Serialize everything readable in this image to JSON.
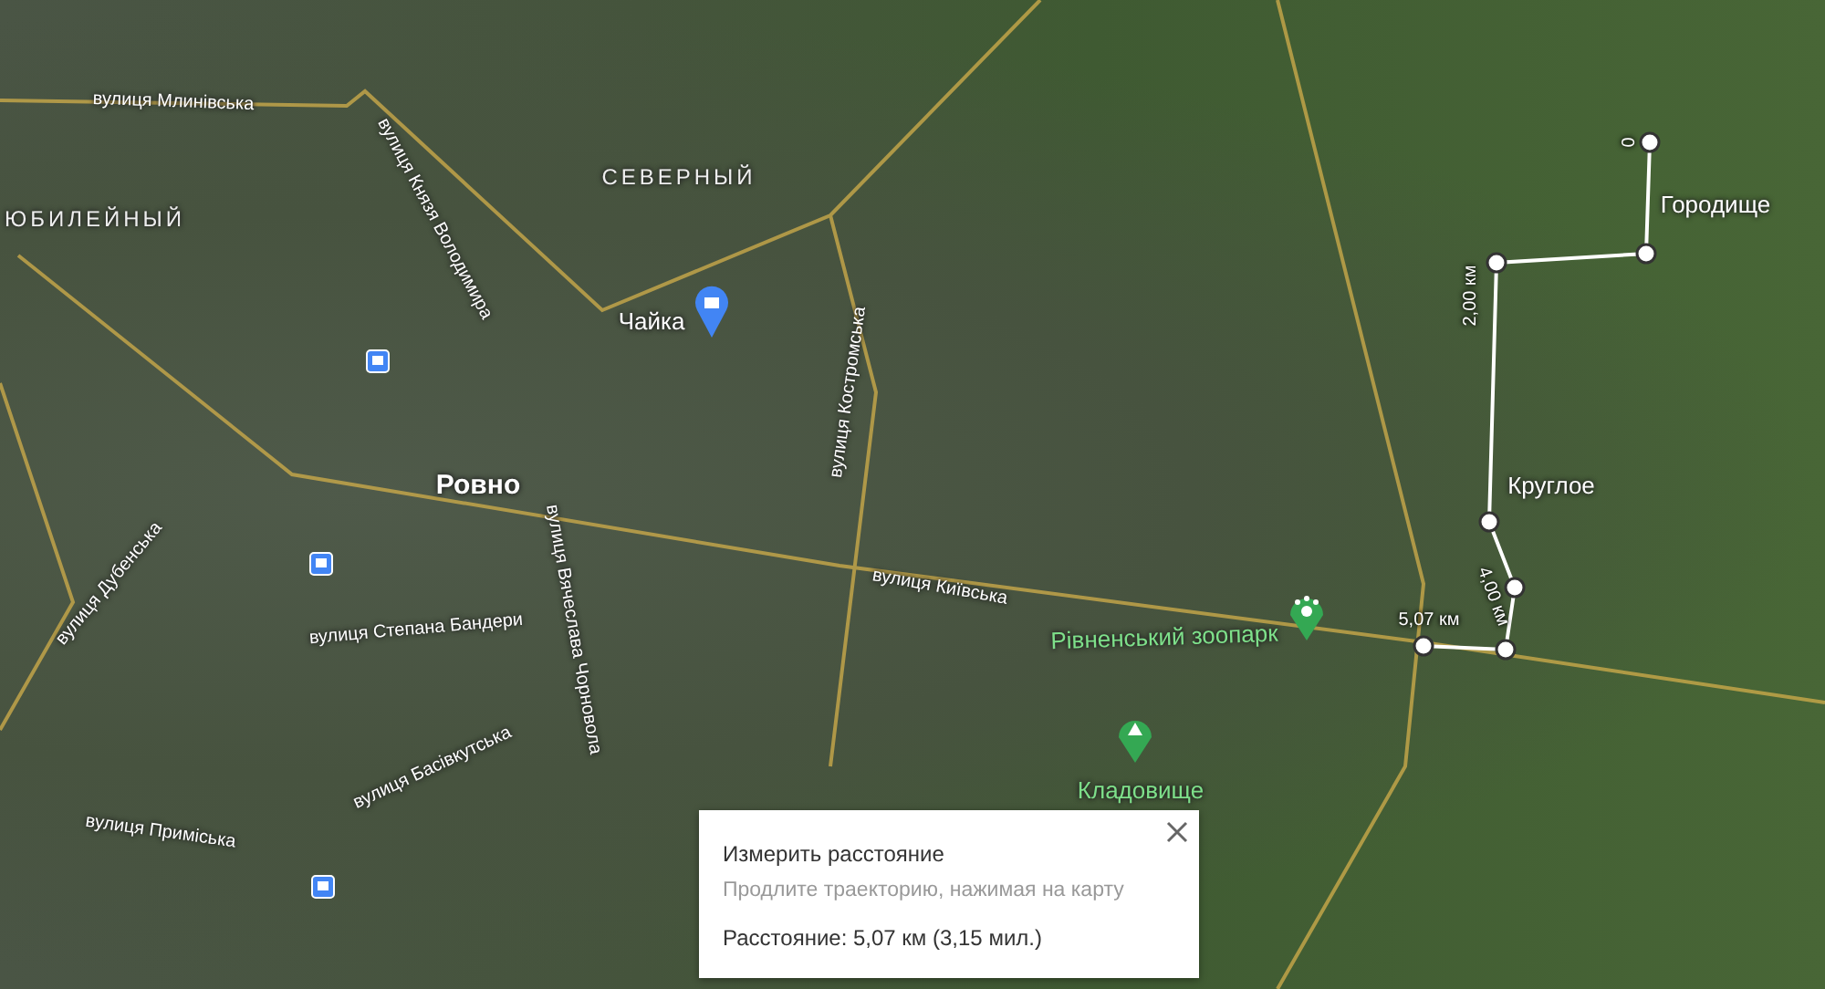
{
  "map": {
    "labels": [
      {
        "text": "вулиця Млинівська",
        "kind": "street"
      },
      {
        "text": "вулиця Князя Володимира",
        "kind": "street"
      },
      {
        "text": "СЕВЕРНЫЙ",
        "kind": "district"
      },
      {
        "text": "ЮБИЛЕЙНЫЙ",
        "kind": "district"
      },
      {
        "text": "Чайка",
        "kind": "place"
      },
      {
        "text": "вулиця Костромська",
        "kind": "street"
      },
      {
        "text": "Ровно",
        "kind": "city"
      },
      {
        "text": "вулиця Київська",
        "kind": "street"
      },
      {
        "text": "вулиця Степана Бандери",
        "kind": "street"
      },
      {
        "text": "вулиця Басівкутська",
        "kind": "street"
      },
      {
        "text": "вулиця Приміська",
        "kind": "street"
      },
      {
        "text": "вулиця Дубенська",
        "kind": "street"
      },
      {
        "text": "вулиця Вячеслава Чорновола",
        "kind": "street"
      },
      {
        "text": "Рівненський зоопарк",
        "kind": "poi"
      },
      {
        "text": "Кладовище",
        "kind": "poi"
      },
      {
        "text": "Городище",
        "kind": "place"
      },
      {
        "text": "Круглое",
        "kind": "place"
      }
    ],
    "measure_labels": [
      "0",
      "2,00 км",
      "4,00 км",
      "5,07 км"
    ]
  },
  "measure_card": {
    "title": "Измерить расстояние",
    "hint": "Продлите траекторию, нажимая на карту",
    "distance": "Расстояние: 5,07 км (3,15 мил.)"
  }
}
